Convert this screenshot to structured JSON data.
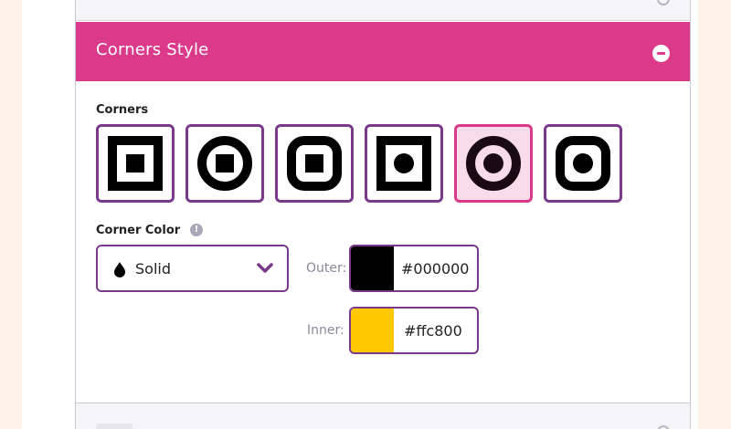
{
  "section": {
    "title": "Corners Style"
  },
  "corners": {
    "label": "Corners",
    "options": [
      {
        "name": "square-square"
      },
      {
        "name": "circle-square"
      },
      {
        "name": "rounded-square"
      },
      {
        "name": "square-dot"
      },
      {
        "name": "circle-dot",
        "selected": true
      },
      {
        "name": "rounded-dot"
      }
    ]
  },
  "corner_color": {
    "label": "Corner Color",
    "mode": "Solid",
    "outer": {
      "label": "Outer:",
      "value": "#000000",
      "color": "#000000"
    },
    "inner": {
      "label": "Inner:",
      "value": "#ffc800",
      "color": "#ffc800"
    }
  },
  "colors": {
    "accent": "#db3a8b",
    "border": "#7a3a8c",
    "page_bg": "#fdf3e9"
  }
}
